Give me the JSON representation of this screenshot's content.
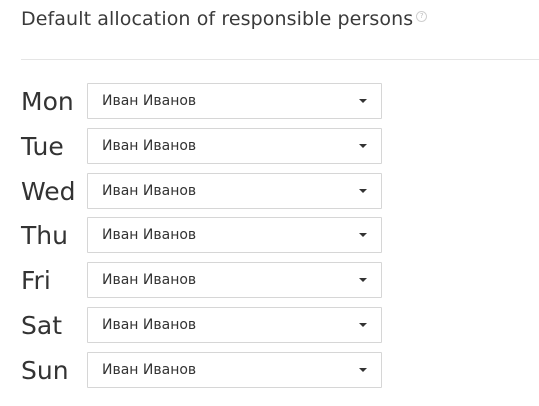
{
  "section": {
    "title": "Default allocation of responsible persons",
    "help_icon": "question-circle-icon",
    "help_glyph": "?"
  },
  "days": [
    {
      "label": "Mon",
      "selected": "Иван Иванов"
    },
    {
      "label": "Tue",
      "selected": "Иван Иванов"
    },
    {
      "label": "Wed",
      "selected": "Иван Иванов"
    },
    {
      "label": "Thu",
      "selected": "Иван Иванов"
    },
    {
      "label": "Fri",
      "selected": "Иван Иванов"
    },
    {
      "label": "Sat",
      "selected": "Иван Иванов"
    },
    {
      "label": "Sun",
      "selected": "Иван Иванов"
    }
  ],
  "colors": {
    "text": "#333333",
    "border": "#d6d6d6",
    "divider": "#e5e5e5"
  }
}
